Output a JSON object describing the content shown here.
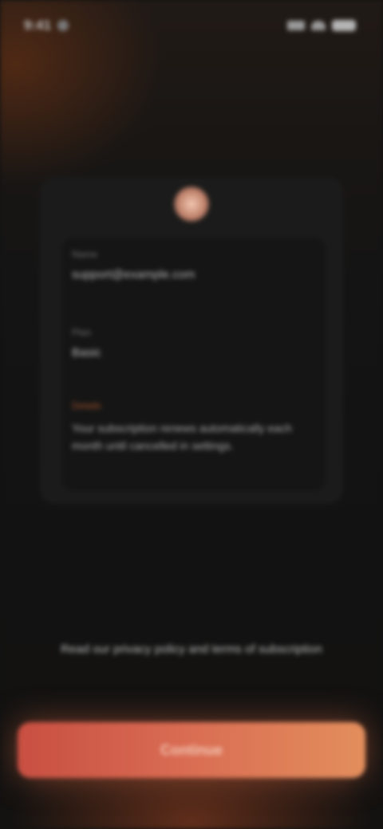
{
  "status_bar": {
    "time": "9:41",
    "icons": [
      "signal-icon",
      "wifi-icon",
      "battery-icon"
    ]
  },
  "card": {
    "logo_icon": "app-logo-icon",
    "fields": [
      {
        "label": "Name",
        "value": "support@example.com"
      },
      {
        "label": "Plan",
        "value": "Basic"
      },
      {
        "label": "Details",
        "value": "Your subscription renews automatically each month until cancelled in settings."
      }
    ]
  },
  "disclaimer": "Read our privacy policy and terms of subscription",
  "primary_button": {
    "label": "Continue"
  },
  "colors": {
    "background": "#121212",
    "card": "#1b1b1b",
    "accent": "#d86a52"
  }
}
